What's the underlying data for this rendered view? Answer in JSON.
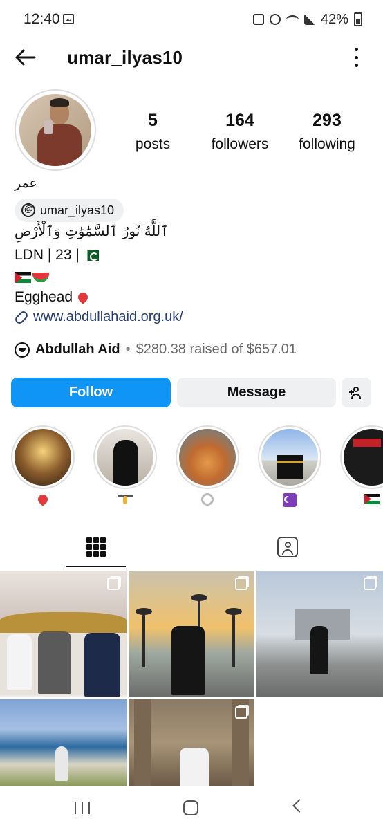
{
  "status_bar": {
    "time": "12:40",
    "battery": "42%"
  },
  "header": {
    "username": "umar_ilyas10"
  },
  "stats": {
    "posts_count": "5",
    "posts_label": "posts",
    "followers_count": "164",
    "followers_label": "followers",
    "following_count": "293",
    "following_label": "following"
  },
  "bio": {
    "name": "عمر",
    "threads_handle": "umar_ilyas10",
    "arabic_line": "ٱللَّهُ نُورُ ٱلسَّمَٰوَٰتِ وَٱلْأَرْضِ",
    "location_line": "LDN | 23 |",
    "egghead_line": "Egghead",
    "link": "www.abdullahaid.org.uk/"
  },
  "fundraiser": {
    "name": "Abdullah Aid",
    "separator": "•",
    "raised_text": "$280.38 raised of $657.01"
  },
  "actions": {
    "follow_label": "Follow",
    "message_label": "Message"
  },
  "highlights": [
    {
      "icon": "pin-icon"
    },
    {
      "icon": "weightlifter-icon"
    },
    {
      "icon": "plate-icon"
    },
    {
      "icon": "star-and-crescent-icon"
    },
    {
      "icon": "palestine-flag-icon"
    }
  ],
  "tabs": [
    {
      "icon": "grid-icon",
      "active": true
    },
    {
      "icon": "tagged-icon",
      "active": false
    }
  ],
  "colors": {
    "follow_button": "#0f95f6",
    "secondary_button": "#eff0f2",
    "link": "#233b6e"
  }
}
